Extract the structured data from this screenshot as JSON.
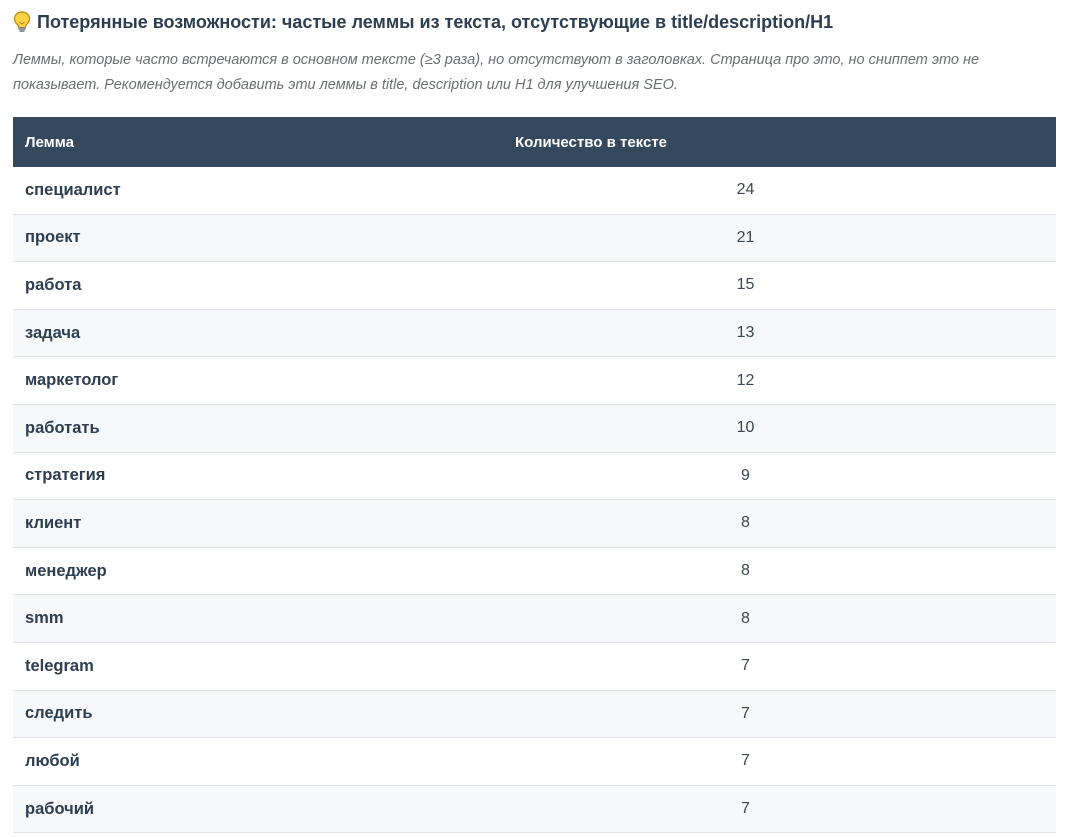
{
  "section": {
    "title": "Потерянные возможности: частые леммы из текста, отсутствующие в title/description/H1",
    "icon": "lightbulb-icon",
    "description": "Леммы, которые часто встречаются в основном тексте (≥3 раза), но отсутствуют в заголовках. Страница про это, но сниппет это не показывает. Рекомендуется добавить эти леммы в title, description или H1 для улучшения SEO."
  },
  "table": {
    "headers": {
      "lemma": "Лемма",
      "count": "Количество в тексте"
    },
    "rows": [
      {
        "lemma": "специалист",
        "count": "24"
      },
      {
        "lemma": "проект",
        "count": "21"
      },
      {
        "lemma": "работа",
        "count": "15"
      },
      {
        "lemma": "задача",
        "count": "13"
      },
      {
        "lemma": "маркетолог",
        "count": "12"
      },
      {
        "lemma": "работать",
        "count": "10"
      },
      {
        "lemma": "стратегия",
        "count": "9"
      },
      {
        "lemma": "клиент",
        "count": "8"
      },
      {
        "lemma": "менеджер",
        "count": "8"
      },
      {
        "lemma": "smm",
        "count": "8"
      },
      {
        "lemma": "telegram",
        "count": "7"
      },
      {
        "lemma": "следить",
        "count": "7"
      },
      {
        "lemma": "любой",
        "count": "7"
      },
      {
        "lemma": "рабочий",
        "count": "7"
      }
    ]
  },
  "colors": {
    "header_bg": "#34495e",
    "header_text": "#ffffff",
    "row_alt_bg": "#f7f8fa",
    "text": "#2c3e50"
  }
}
